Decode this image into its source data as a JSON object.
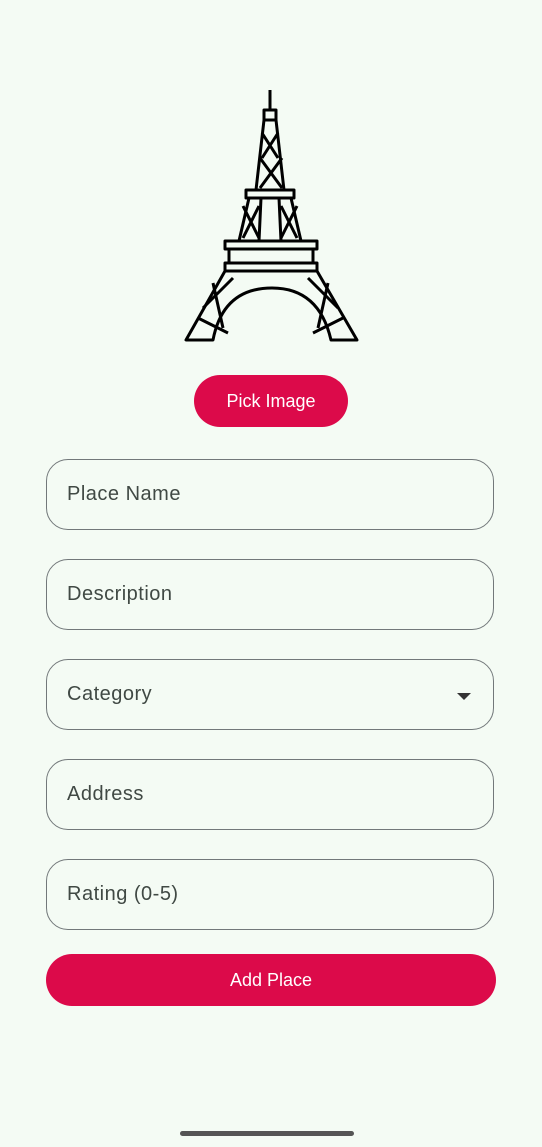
{
  "pick_image": "Pick Image",
  "fields": [
    "Place Name",
    "Description",
    "Category",
    "Address",
    "Rating (0-5)"
  ],
  "add_place": "Add Place",
  "image_icon": "eiffel-tower-image",
  "colors": {
    "accent": "#dc0a4a",
    "background": "#f4fbf4"
  }
}
